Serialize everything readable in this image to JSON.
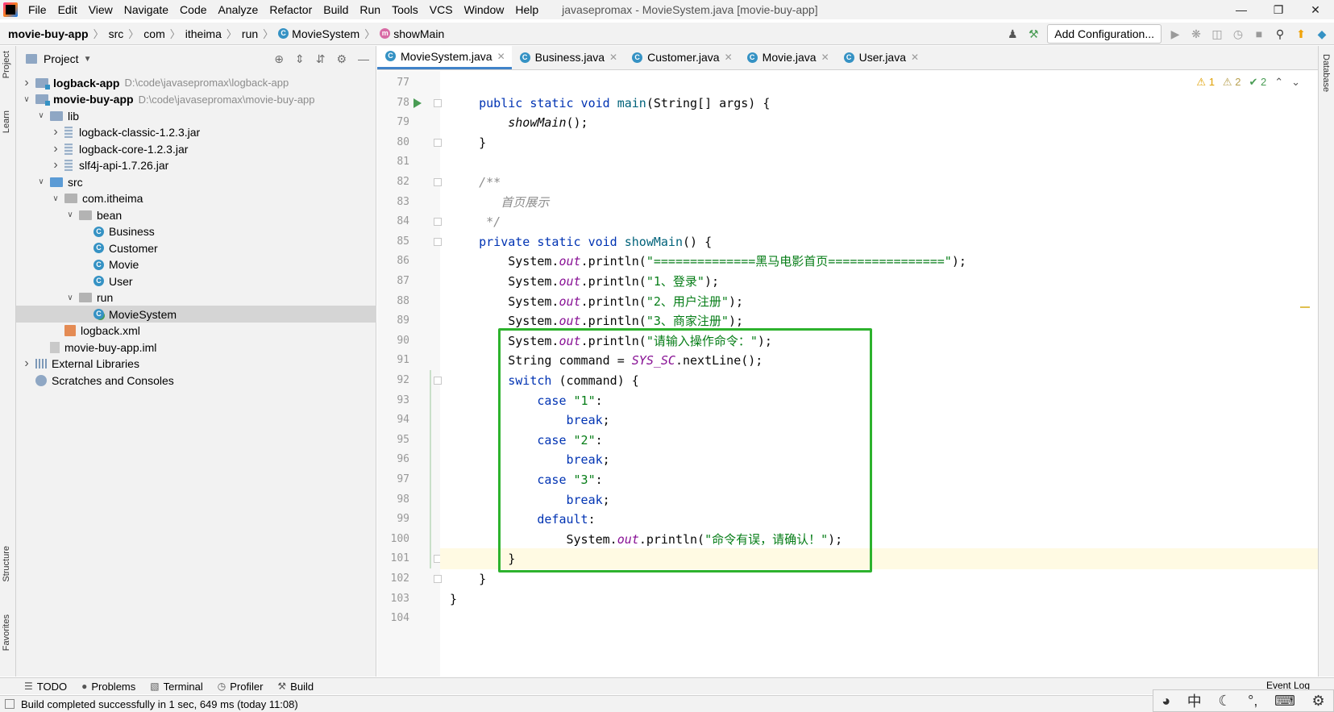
{
  "menu": [
    "File",
    "Edit",
    "View",
    "Navigate",
    "Code",
    "Analyze",
    "Refactor",
    "Build",
    "Run",
    "Tools",
    "VCS",
    "Window",
    "Help"
  ],
  "window_title": "javasepromax - MovieSystem.java [movie-buy-app]",
  "breadcrumb": {
    "project": "movie-buy-app",
    "path": [
      "src",
      "com",
      "itheima",
      "run"
    ],
    "class": "MovieSystem",
    "method": "showMain"
  },
  "toolbar": {
    "add_config": "Add Configuration..."
  },
  "strips": {
    "project": "Project",
    "learn": "Learn",
    "structure": "Structure",
    "favorites": "Favorites",
    "database": "Database"
  },
  "project_panel": {
    "title": "Project",
    "tree": [
      {
        "label": "logback-app",
        "path": "D:\\code\\javasepromax\\logback-app",
        "icon": "module-folder",
        "depth": 0,
        "arrow": "right",
        "bold": true
      },
      {
        "label": "movie-buy-app",
        "path": "D:\\code\\javasepromax\\movie-buy-app",
        "icon": "module-folder",
        "depth": 0,
        "arrow": "down",
        "bold": true
      },
      {
        "label": "lib",
        "icon": "folder",
        "depth": 1,
        "arrow": "down"
      },
      {
        "label": "logback-classic-1.2.3.jar",
        "icon": "jar",
        "depth": 2,
        "arrow": "right"
      },
      {
        "label": "logback-core-1.2.3.jar",
        "icon": "jar",
        "depth": 2,
        "arrow": "right"
      },
      {
        "label": "slf4j-api-1.7.26.jar",
        "icon": "jar",
        "depth": 2,
        "arrow": "right"
      },
      {
        "label": "src",
        "icon": "source-folder",
        "depth": 1,
        "arrow": "down"
      },
      {
        "label": "com.itheima",
        "icon": "package",
        "depth": 2,
        "arrow": "down"
      },
      {
        "label": "bean",
        "icon": "package",
        "depth": 3,
        "arrow": "down"
      },
      {
        "label": "Business",
        "icon": "class",
        "depth": 4,
        "arrow": ""
      },
      {
        "label": "Customer",
        "icon": "class",
        "depth": 4,
        "arrow": ""
      },
      {
        "label": "Movie",
        "icon": "class",
        "depth": 4,
        "arrow": ""
      },
      {
        "label": "User",
        "icon": "class",
        "depth": 4,
        "arrow": ""
      },
      {
        "label": "run",
        "icon": "package",
        "depth": 3,
        "arrow": "down"
      },
      {
        "label": "MovieSystem",
        "icon": "main-class",
        "depth": 4,
        "arrow": "",
        "selected": true
      },
      {
        "label": "logback.xml",
        "icon": "xml",
        "depth": 2,
        "arrow": ""
      },
      {
        "label": "movie-buy-app.iml",
        "icon": "iml",
        "depth": 1,
        "arrow": ""
      },
      {
        "label": "External Libraries",
        "icon": "libraries",
        "depth": 0,
        "arrow": "right"
      },
      {
        "label": "Scratches and Consoles",
        "icon": "scratches",
        "depth": 0,
        "arrow": ""
      }
    ]
  },
  "tabs": [
    {
      "label": "MovieSystem.java",
      "active": true
    },
    {
      "label": "Business.java",
      "active": false
    },
    {
      "label": "Customer.java",
      "active": false
    },
    {
      "label": "Movie.java",
      "active": false
    },
    {
      "label": "User.java",
      "active": false
    }
  ],
  "inspection": {
    "warnings": "1",
    "weak_warnings": "2",
    "typos": "2"
  },
  "code": [
    {
      "n": "77",
      "tokens": []
    },
    {
      "n": "78",
      "run": true,
      "fold": true,
      "tokens": [
        [
          "",
          "    "
        ],
        [
          "kw",
          "public static void "
        ],
        [
          "mth",
          "main"
        ],
        [
          "",
          "(String[] args) {"
        ]
      ]
    },
    {
      "n": "79",
      "tokens": [
        [
          "",
          "        "
        ],
        [
          "itl",
          "showMain"
        ],
        [
          "",
          "();"
        ]
      ]
    },
    {
      "n": "80",
      "fold": true,
      "tokens": [
        [
          "",
          "    }"
        ]
      ]
    },
    {
      "n": "81",
      "tokens": []
    },
    {
      "n": "82",
      "fold": true,
      "tokens": [
        [
          "cmt",
          "    /**"
        ]
      ]
    },
    {
      "n": "83",
      "tokens": [
        [
          "cmt",
          "       首页展示"
        ]
      ]
    },
    {
      "n": "84",
      "fold": true,
      "tokens": [
        [
          "cmt",
          "     */"
        ]
      ]
    },
    {
      "n": "85",
      "fold": true,
      "tokens": [
        [
          "",
          "    "
        ],
        [
          "kw",
          "private static void "
        ],
        [
          "mth",
          "showMain"
        ],
        [
          "",
          "() {"
        ]
      ]
    },
    {
      "n": "86",
      "tokens": [
        [
          "",
          "        System."
        ],
        [
          "fld",
          "out"
        ],
        [
          "",
          ".println("
        ],
        [
          "str",
          "\"==============黑马电影首页================\""
        ],
        [
          "",
          ");"
        ]
      ]
    },
    {
      "n": "87",
      "tokens": [
        [
          "",
          "        System."
        ],
        [
          "fld",
          "out"
        ],
        [
          "",
          ".println("
        ],
        [
          "str",
          "\"1、登录\""
        ],
        [
          "",
          ");"
        ]
      ]
    },
    {
      "n": "88",
      "tokens": [
        [
          "",
          "        System."
        ],
        [
          "fld",
          "out"
        ],
        [
          "",
          ".println("
        ],
        [
          "str",
          "\"2、用户注册\""
        ],
        [
          "",
          ");"
        ]
      ]
    },
    {
      "n": "89",
      "tokens": [
        [
          "",
          "        System."
        ],
        [
          "fld",
          "out"
        ],
        [
          "",
          ".println("
        ],
        [
          "str",
          "\"3、商家注册\""
        ],
        [
          "",
          ");"
        ]
      ]
    },
    {
      "n": "90",
      "tokens": [
        [
          "",
          "        System."
        ],
        [
          "fld",
          "out"
        ],
        [
          "",
          ".println("
        ],
        [
          "str",
          "\"请输入操作命令：\""
        ],
        [
          "",
          ");"
        ]
      ]
    },
    {
      "n": "91",
      "tokens": [
        [
          "",
          "        String command = "
        ],
        [
          "fld",
          "SYS_SC"
        ],
        [
          "",
          ".nextLine();"
        ]
      ]
    },
    {
      "n": "92",
      "fold": true,
      "tokens": [
        [
          "",
          "        "
        ],
        [
          "kw",
          "switch"
        ],
        [
          "",
          " (command) {"
        ]
      ]
    },
    {
      "n": "93",
      "tokens": [
        [
          "",
          "            "
        ],
        [
          "kw",
          "case "
        ],
        [
          "str",
          "\"1\""
        ],
        [
          "",
          ":"
        ]
      ]
    },
    {
      "n": "94",
      "tokens": [
        [
          "",
          "                "
        ],
        [
          "kw",
          "break"
        ],
        [
          "",
          ";"
        ]
      ]
    },
    {
      "n": "95",
      "tokens": [
        [
          "",
          "            "
        ],
        [
          "kw",
          "case "
        ],
        [
          "str",
          "\"2\""
        ],
        [
          "",
          ":"
        ]
      ]
    },
    {
      "n": "96",
      "tokens": [
        [
          "",
          "                "
        ],
        [
          "kw",
          "break"
        ],
        [
          "",
          ";"
        ]
      ]
    },
    {
      "n": "97",
      "tokens": [
        [
          "",
          "            "
        ],
        [
          "kw",
          "case "
        ],
        [
          "str",
          "\"3\""
        ],
        [
          "",
          ":"
        ]
      ]
    },
    {
      "n": "98",
      "tokens": [
        [
          "",
          "                "
        ],
        [
          "kw",
          "break"
        ],
        [
          "",
          ";"
        ]
      ]
    },
    {
      "n": "99",
      "tokens": [
        [
          "",
          "            "
        ],
        [
          "kw",
          "default"
        ],
        [
          "",
          ":"
        ]
      ]
    },
    {
      "n": "100",
      "tokens": [
        [
          "",
          "                System."
        ],
        [
          "fld",
          "out"
        ],
        [
          "",
          ".println("
        ],
        [
          "str",
          "\"命令有误，请确认！\""
        ],
        [
          "",
          ");"
        ]
      ]
    },
    {
      "n": "101",
      "current": true,
      "fold": true,
      "tokens": [
        [
          "",
          "        }"
        ]
      ]
    },
    {
      "n": "102",
      "fold": true,
      "tokens": [
        [
          "",
          "    }"
        ]
      ]
    },
    {
      "n": "103",
      "tokens": [
        [
          "",
          "}"
        ]
      ]
    },
    {
      "n": "104",
      "tokens": []
    }
  ],
  "bottom_tools": [
    "TODO",
    "Problems",
    "Terminal",
    "Profiler",
    "Build"
  ],
  "event_log": "Event Log",
  "status": "Build completed successfully in 1 sec, 649 ms (today 11:08)",
  "colors": {
    "highlight_box": "#2db22d",
    "tab_underline": "#4083c9"
  }
}
